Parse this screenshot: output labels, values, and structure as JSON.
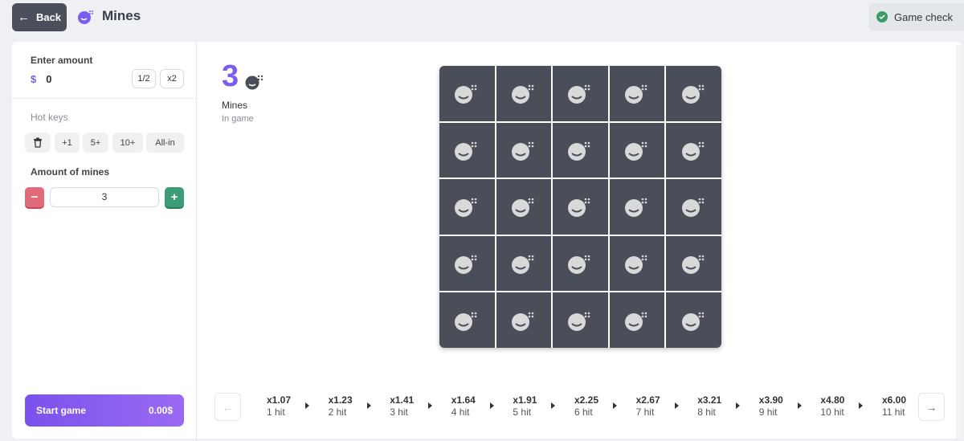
{
  "header": {
    "back_label": "Back",
    "title": "Mines",
    "game_check_label": "Game check"
  },
  "left": {
    "enter_amount_label": "Enter amount",
    "currency_symbol": "$",
    "amount_value": "0",
    "half_label": "1/2",
    "double_label": "x2",
    "hot_keys_label": "Hot keys",
    "hot_keys": [
      "+1",
      "5+",
      "10+",
      "All-in"
    ],
    "mines_label": "Amount of mines",
    "mines_value": "3",
    "minus_label": "−",
    "plus_label": "+",
    "start_label": "Start game",
    "start_amount": "0.00$"
  },
  "main": {
    "mines_count": "3",
    "mines_title": "Mines",
    "mines_sub": "In game",
    "grid_rows": 5,
    "grid_cols": 5,
    "multipliers": [
      {
        "value": "x1.07",
        "hits": "1 hit"
      },
      {
        "value": "x1.23",
        "hits": "2 hit"
      },
      {
        "value": "x1.41",
        "hits": "3 hit"
      },
      {
        "value": "x1.64",
        "hits": "4 hit"
      },
      {
        "value": "x1.91",
        "hits": "5 hit"
      },
      {
        "value": "x2.25",
        "hits": "6 hit"
      },
      {
        "value": "x2.67",
        "hits": "7 hit"
      },
      {
        "value": "x3.21",
        "hits": "8 hit"
      },
      {
        "value": "x3.90",
        "hits": "9 hit"
      },
      {
        "value": "x4.80",
        "hits": "10 hit"
      },
      {
        "value": "x6.00",
        "hits": "11 hit"
      }
    ]
  },
  "colors": {
    "accent": "#7b5cf0",
    "cell": "#4a4e59",
    "minus": "#e06a7a",
    "plus": "#3d9c78"
  },
  "icons": {
    "back": "arrow-left-icon",
    "title": "bomb-icon",
    "check": "check-circle-icon",
    "trash": "trash-icon",
    "prev": "arrow-left-icon",
    "next": "arrow-right-icon"
  }
}
